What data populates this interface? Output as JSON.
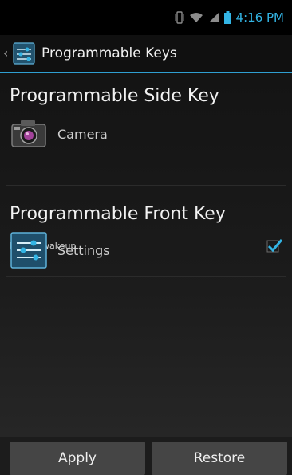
{
  "status_bar": {
    "time": "4:16 PM",
    "icons": [
      "vibrate-icon",
      "wifi-icon",
      "signal-icon",
      "battery-icon"
    ]
  },
  "action_bar": {
    "title": "Programmable Keys",
    "icon": "settings-sliders-icon"
  },
  "side_key": {
    "title": "Programmable Side Key",
    "app_label": "Camera",
    "app_icon": "camera-icon",
    "wakeup_label": "Enable wakeup",
    "wakeup_checked": true
  },
  "front_key": {
    "title": "Programmable Front Key",
    "app_label": "Settings",
    "app_icon": "settings-sliders-icon"
  },
  "buttons": {
    "apply": "Apply",
    "restore": "Restore"
  },
  "colors": {
    "accent": "#33b5e5"
  }
}
